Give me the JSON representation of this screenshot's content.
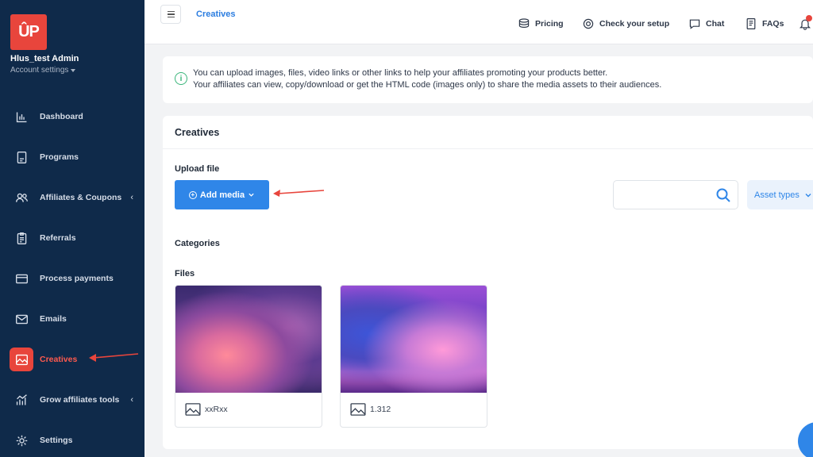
{
  "sidebar": {
    "logo_text": "ÛP",
    "account_name": "Hlus_test Admin",
    "account_settings": "Account settings",
    "items": [
      {
        "label": "Dashboard",
        "icon": "chart-icon"
      },
      {
        "label": "Programs",
        "icon": "document-icon"
      },
      {
        "label": "Affiliates & Coupons",
        "icon": "users-icon",
        "chevron": "‹"
      },
      {
        "label": "Referrals",
        "icon": "clipboard-icon"
      },
      {
        "label": "Process payments",
        "icon": "credit-card-icon"
      },
      {
        "label": "Emails",
        "icon": "mail-icon"
      },
      {
        "label": "Creatives",
        "icon": "image-icon",
        "active": true
      },
      {
        "label": "Grow affiliates tools",
        "icon": "growth-chart-icon",
        "chevron": "‹"
      },
      {
        "label": "Settings",
        "icon": "gear-icon"
      }
    ]
  },
  "topbar": {
    "breadcrumb": "Creatives",
    "pricing": "Pricing",
    "check_setup": "Check your setup",
    "chat": "Chat",
    "faqs": "FAQs"
  },
  "info": {
    "line1": "You can upload images, files, video links or other links to help your affiliates promoting your products better.",
    "line2": "Your affiliates can view, copy/download or get the HTML code (images only) to share the media assets to their audiences."
  },
  "creatives": {
    "title": "Creatives",
    "upload_label": "Upload file",
    "add_media": "Add media",
    "search_placeholder": "",
    "asset_types": "Asset types",
    "categories_label": "Categories",
    "files_label": "Files",
    "files": [
      {
        "name": "xxRxx"
      },
      {
        "name": "1.312"
      }
    ]
  },
  "colors": {
    "sidebar_bg": "#0f2a4a",
    "accent_red": "#e8453c",
    "primary_blue": "#2f86e8",
    "success_green": "#39b57a"
  }
}
